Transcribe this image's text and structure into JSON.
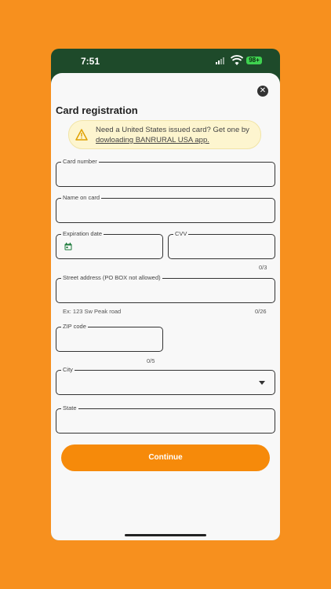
{
  "status": {
    "time": "7:51",
    "battery": "98+"
  },
  "sheet": {
    "title": "Card registration",
    "banner": {
      "text": "Need a United States issued card? Get one by ",
      "link": "dowloading BANRURAL USA app."
    },
    "fields": {
      "card_number": {
        "label": "Card number"
      },
      "name_on_card": {
        "label": "Name on card"
      },
      "expiration_date": {
        "label": "Expiration date"
      },
      "cvv": {
        "label": "CVV",
        "counter": "0/3"
      },
      "street_address": {
        "label": "Street address (PO BOX not allowed)",
        "helper": "Ex: 123 Sw Peak road",
        "counter": "0/26"
      },
      "zip_code": {
        "label": "ZIP code",
        "counter": "0/5"
      },
      "city": {
        "label": "City"
      },
      "state": {
        "label": "State"
      }
    },
    "continue_label": "Continue"
  },
  "colors": {
    "background": "#f7901e",
    "header": "#1e4a2a",
    "button": "#f68a0a",
    "banner": "#fdf5cf"
  }
}
